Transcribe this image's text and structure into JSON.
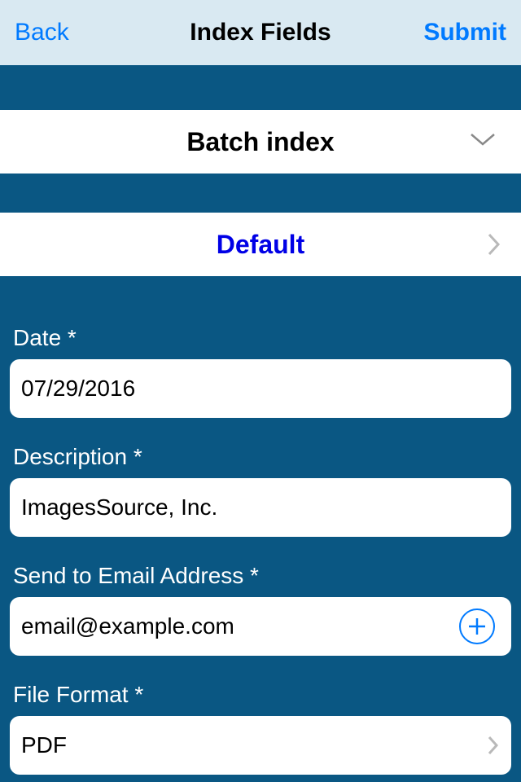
{
  "navbar": {
    "back": "Back",
    "title": "Index Fields",
    "submit": "Submit"
  },
  "batch_row": {
    "label": "Batch index"
  },
  "default_row": {
    "label": "Default"
  },
  "fields": {
    "date": {
      "label": "Date *",
      "value": "07/29/2016"
    },
    "description": {
      "label": "Description *",
      "value": "ImagesSource, Inc."
    },
    "email": {
      "label": "Send to Email Address *",
      "value": "email@example.com"
    },
    "file_format": {
      "label": "File Format *",
      "value": "PDF"
    }
  }
}
